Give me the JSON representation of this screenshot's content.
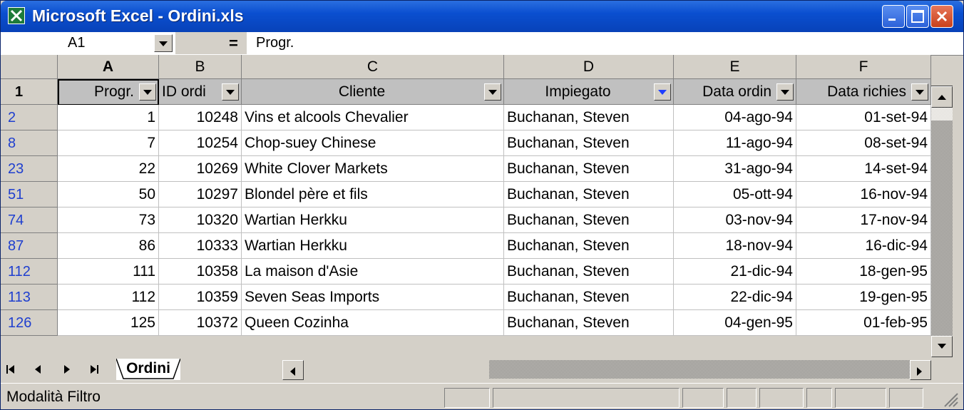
{
  "window": {
    "title": "Microsoft Excel - Ordini.xls"
  },
  "formula_bar": {
    "cell_ref": "A1",
    "equals": "=",
    "value": "Progr."
  },
  "columns": [
    "A",
    "B",
    "C",
    "D",
    "E",
    "F"
  ],
  "row1": {
    "number": "1",
    "headers": [
      "Progr.",
      "ID ordi",
      "Cliente",
      "Impiegato",
      "Data ordin",
      "Data richies"
    ]
  },
  "rows": [
    {
      "num": "2",
      "progr": "1",
      "id": "10248",
      "cliente": "Vins et alcools Chevalier",
      "impiegato": "Buchanan, Steven",
      "data_ordine": "04-ago-94",
      "data_richiesta": "01-set-94"
    },
    {
      "num": "8",
      "progr": "7",
      "id": "10254",
      "cliente": "Chop-suey Chinese",
      "impiegato": "Buchanan, Steven",
      "data_ordine": "11-ago-94",
      "data_richiesta": "08-set-94"
    },
    {
      "num": "23",
      "progr": "22",
      "id": "10269",
      "cliente": "White Clover Markets",
      "impiegato": "Buchanan, Steven",
      "data_ordine": "31-ago-94",
      "data_richiesta": "14-set-94"
    },
    {
      "num": "51",
      "progr": "50",
      "id": "10297",
      "cliente": "Blondel père et fils",
      "impiegato": "Buchanan, Steven",
      "data_ordine": "05-ott-94",
      "data_richiesta": "16-nov-94"
    },
    {
      "num": "74",
      "progr": "73",
      "id": "10320",
      "cliente": "Wartian Herkku",
      "impiegato": "Buchanan, Steven",
      "data_ordine": "03-nov-94",
      "data_richiesta": "17-nov-94"
    },
    {
      "num": "87",
      "progr": "86",
      "id": "10333",
      "cliente": "Wartian Herkku",
      "impiegato": "Buchanan, Steven",
      "data_ordine": "18-nov-94",
      "data_richiesta": "16-dic-94"
    },
    {
      "num": "112",
      "progr": "111",
      "id": "10358",
      "cliente": "La maison d'Asie",
      "impiegato": "Buchanan, Steven",
      "data_ordine": "21-dic-94",
      "data_richiesta": "18-gen-95"
    },
    {
      "num": "113",
      "progr": "112",
      "id": "10359",
      "cliente": "Seven Seas Imports",
      "impiegato": "Buchanan, Steven",
      "data_ordine": "22-dic-94",
      "data_richiesta": "19-gen-95"
    },
    {
      "num": "126",
      "progr": "125",
      "id": "10372",
      "cliente": "Queen Cozinha",
      "impiegato": "Buchanan, Steven",
      "data_ordine": "04-gen-95",
      "data_richiesta": "01-feb-95"
    }
  ],
  "sheet_tab": "Ordini",
  "status": {
    "mode": "Modalità Filtro"
  },
  "icons": {
    "app": "excel-icon",
    "minimize": "minimize-icon",
    "maximize": "maximize-icon",
    "close": "close-icon"
  },
  "colors": {
    "titlebar": "#0a4fd0",
    "row_number": "#1f3fcf",
    "filter_active": "#1f3fff"
  }
}
